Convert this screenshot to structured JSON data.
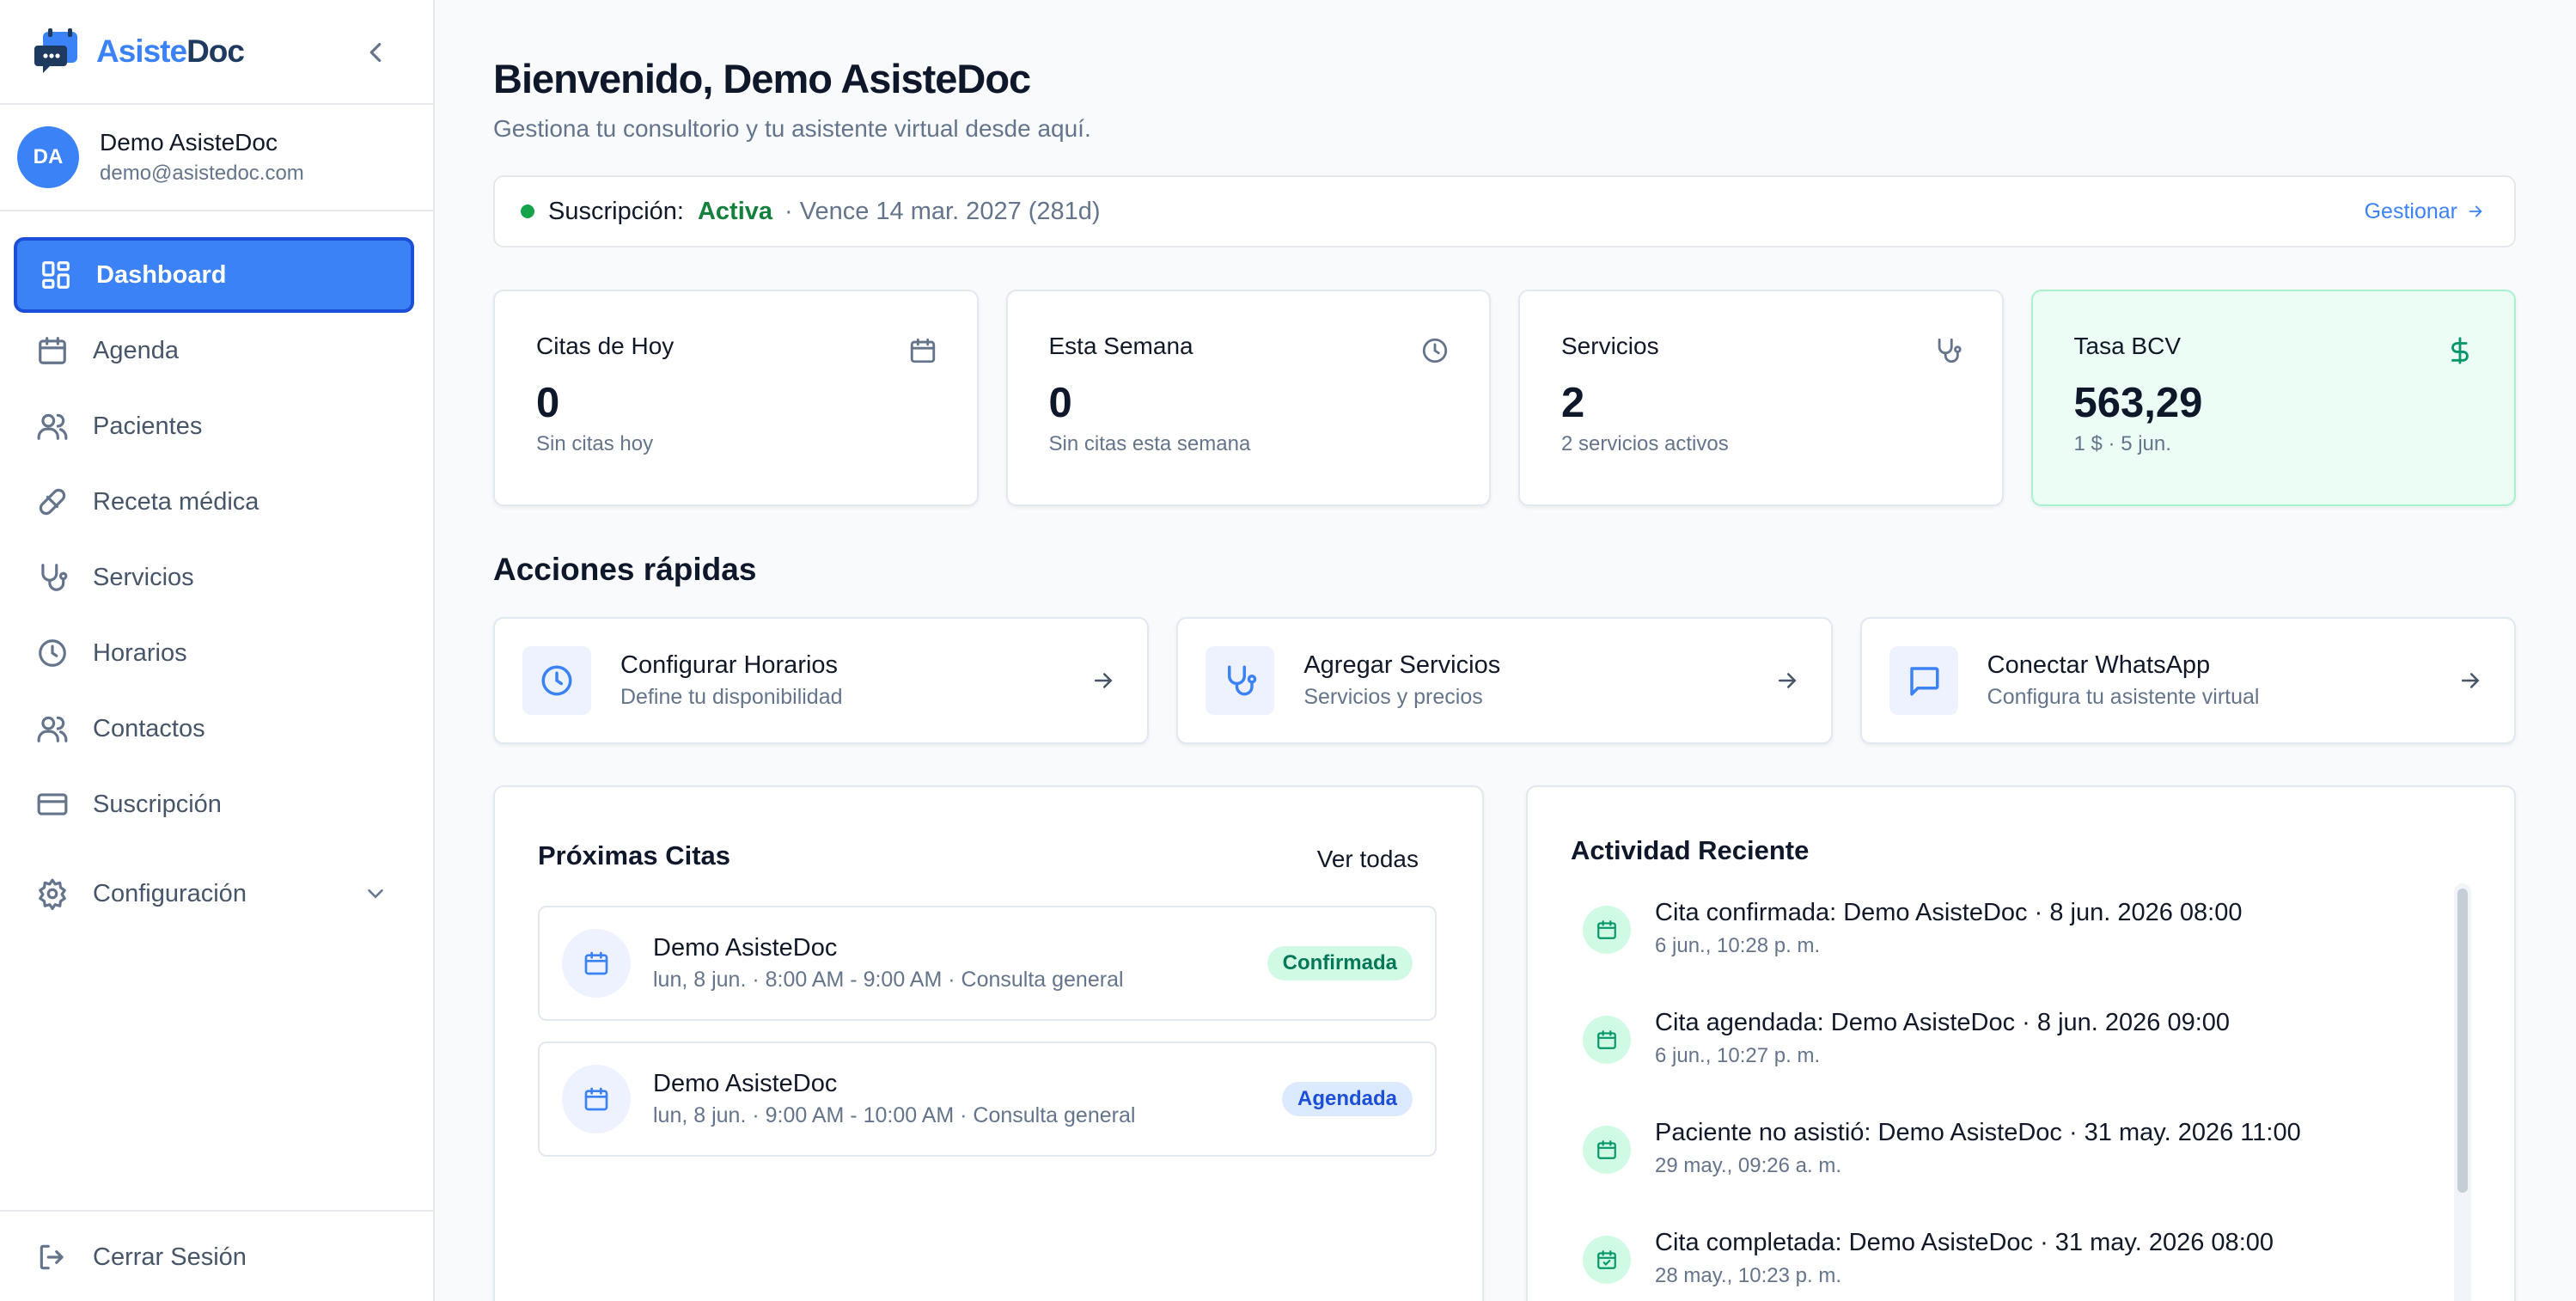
{
  "brand": {
    "name_part1": "Asiste",
    "name_part2": "Doc"
  },
  "user": {
    "initials": "DA",
    "name": "Demo AsisteDoc",
    "email": "demo@asistedoc.com"
  },
  "nav": {
    "items": [
      {
        "label": "Dashboard",
        "icon": "dashboard-icon"
      },
      {
        "label": "Agenda",
        "icon": "calendar-icon"
      },
      {
        "label": "Pacientes",
        "icon": "users-icon"
      },
      {
        "label": "Receta médica",
        "icon": "pill-icon"
      },
      {
        "label": "Servicios",
        "icon": "stethoscope-icon"
      },
      {
        "label": "Horarios",
        "icon": "clock-icon"
      },
      {
        "label": "Contactos",
        "icon": "contacts-icon"
      },
      {
        "label": "Suscripción",
        "icon": "credit-card-icon"
      },
      {
        "label": "Configuración",
        "icon": "gear-icon"
      }
    ],
    "logout": "Cerrar Sesión"
  },
  "header": {
    "title": "Bienvenido, Demo AsisteDoc",
    "subtitle": "Gestiona tu consultorio y tu asistente virtual desde aquí."
  },
  "subscription": {
    "label": "Suscripción:",
    "status": "Activa",
    "expiry": "· Vence 14 mar. 2027 (281d)",
    "manage": "Gestionar",
    "status_color": "#16a34a"
  },
  "stats": [
    {
      "label": "Citas de Hoy",
      "value": "0",
      "sub": "Sin citas hoy",
      "icon": "calendar-icon"
    },
    {
      "label": "Esta Semana",
      "value": "0",
      "sub": "Sin citas esta semana",
      "icon": "clock-icon"
    },
    {
      "label": "Servicios",
      "value": "2",
      "sub": "2 servicios activos",
      "icon": "stethoscope-icon"
    },
    {
      "label": "Tasa BCV",
      "value": "563,29",
      "sub": "1 $ · 5 jun.",
      "icon": "dollar-icon"
    }
  ],
  "quick_actions": {
    "title": "Acciones rápidas",
    "items": [
      {
        "title": "Configurar Horarios",
        "sub": "Define tu disponibilidad",
        "icon": "clock-icon"
      },
      {
        "title": "Agregar Servicios",
        "sub": "Servicios y precios",
        "icon": "stethoscope-icon"
      },
      {
        "title": "Conectar WhatsApp",
        "sub": "Configura tu asistente virtual",
        "icon": "message-icon"
      }
    ]
  },
  "upcoming": {
    "title": "Próximas Citas",
    "see_all": "Ver todas",
    "items": [
      {
        "name": "Demo AsisteDoc",
        "meta": "lun, 8 jun. · 8:00 AM - 9:00 AM · Consulta general",
        "status": "Confirmada"
      },
      {
        "name": "Demo AsisteDoc",
        "meta": "lun, 8 jun. · 9:00 AM - 10:00 AM · Consulta general",
        "status": "Agendada"
      }
    ]
  },
  "activity": {
    "title": "Actividad Reciente",
    "items": [
      {
        "text": "Cita confirmada: Demo AsisteDoc · 8 jun. 2026 08:00",
        "time": "6 jun., 10:28 p. m."
      },
      {
        "text": "Cita agendada: Demo AsisteDoc · 8 jun. 2026 09:00",
        "time": "6 jun., 10:27 p. m."
      },
      {
        "text": "Paciente no asistió: Demo AsisteDoc · 31 may. 2026 11:00",
        "time": "29 may., 09:26 a. m."
      },
      {
        "text": "Cita completada: Demo AsisteDoc · 31 may. 2026 08:00",
        "time": "28 may., 10:23 p. m."
      }
    ]
  },
  "colors": {
    "accent": "#3b82f6",
    "success": "#059669",
    "text": "#0f172a"
  }
}
